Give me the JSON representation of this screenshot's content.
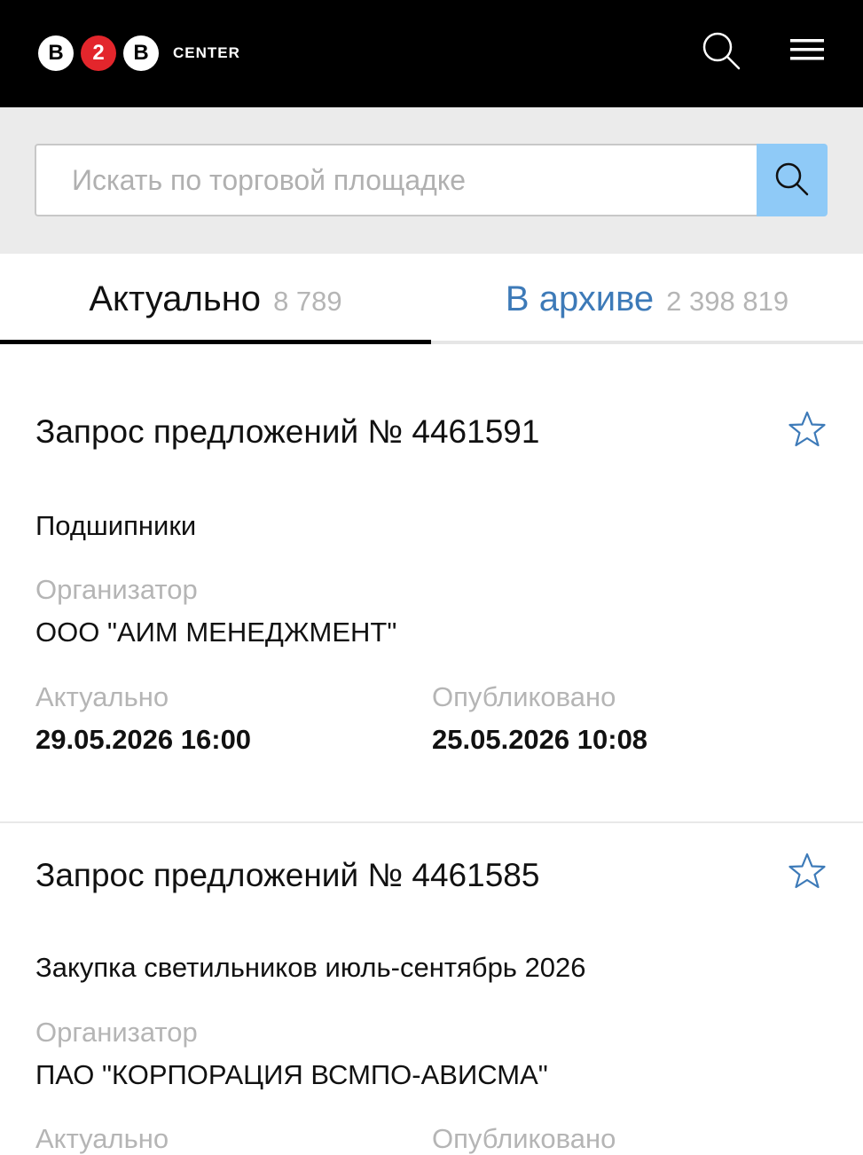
{
  "header": {
    "logo": {
      "letters": [
        "B",
        "2",
        "B"
      ],
      "word": "CENTER"
    },
    "icons": {
      "search": "search-icon",
      "menu": "hamburger-menu-icon"
    }
  },
  "search": {
    "placeholder": "Искать по торговой площадке",
    "value": ""
  },
  "tabs": [
    {
      "label": "Актуально",
      "count": "8 789",
      "active": true
    },
    {
      "label": "В архиве",
      "count": "2 398 819",
      "active": false
    }
  ],
  "cards": [
    {
      "title": "Запрос предложений № 4461591",
      "subject": "Подшипники",
      "organizer_label": "Организатор",
      "organizer": "ООО \"АИМ МЕНЕДЖМЕНТ\"",
      "actual_label": "Актуально",
      "actual": "29.05.2026 16:00",
      "published_label": "Опубликовано",
      "published": "25.05.2026 10:08"
    },
    {
      "title": "Запрос предложений № 4461585",
      "subject": "Закупка светильников июль-сентябрь 2026",
      "organizer_label": "Организатор",
      "organizer": "ПАО \"КОРПОРАЦИЯ ВСМПО-АВИСМА\"",
      "actual_label": "Актуально",
      "published_label": "Опубликовано"
    }
  ],
  "colors": {
    "header_bg": "#000000",
    "logo_red": "#e3262c",
    "search_button": "#8fcaf7",
    "archive_tab": "#3d7ab8",
    "star": "#3d7ab8",
    "muted_text": "#b5b5b5"
  }
}
